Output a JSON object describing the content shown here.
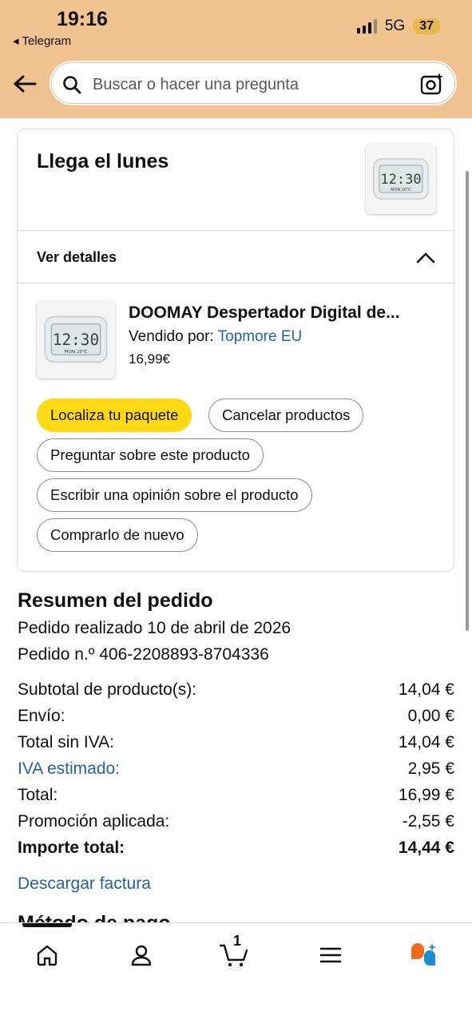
{
  "status_bar": {
    "time": "19:16",
    "back_app": "Telegram",
    "network": "5G",
    "battery": "37"
  },
  "search": {
    "placeholder": "Buscar o hacer una pregunta"
  },
  "delivery": {
    "arrival": "Llega el lunes",
    "details_label": "Ver detalles",
    "product": {
      "title": "DOOMAY Despertador Digital de...",
      "seller_label": "Vendido por:",
      "seller_name": "Topmore EU",
      "price": "16,99€"
    },
    "actions": {
      "track": "Localiza tu paquete",
      "cancel": "Cancelar productos",
      "ask": "Preguntar sobre este producto",
      "review": "Escribir una opinión sobre el producto",
      "rebuy": "Comprarlo de nuevo"
    }
  },
  "summary": {
    "title": "Resumen del pedido",
    "date": "Pedido realizado 10 de abril de 2026",
    "order_number": "Pedido n.º 406-2208893-8704336",
    "rows": [
      {
        "label": "Subtotal de producto(s):",
        "value": "14,04 €"
      },
      {
        "label": "Envío:",
        "value": "0,00 €"
      },
      {
        "label": "Total sin IVA:",
        "value": "14,04 €"
      },
      {
        "label": "IVA estimado:",
        "value": "2,95 €"
      },
      {
        "label": "Total:",
        "value": "16,99 €"
      },
      {
        "label": "Promoción aplicada:",
        "value": "-2,55 €"
      },
      {
        "label": "Importe total:",
        "value": "14,44 €"
      }
    ],
    "download_invoice": "Descargar factura",
    "next_section": "Método de pago"
  },
  "bottom_nav": {
    "cart_count": "1"
  },
  "colors": {
    "header_bg": "#f1c48f",
    "link": "#2162a1",
    "primary_button": "#ffd814",
    "assistant_orange": "#f26b1d",
    "assistant_blue": "#1a8cd8"
  },
  "icons": [
    "arrow-left-icon",
    "search-icon",
    "camera-sparkle-icon",
    "chevron-up-icon",
    "home-icon",
    "user-icon",
    "cart-icon",
    "menu-icon",
    "assistant-icon"
  ]
}
